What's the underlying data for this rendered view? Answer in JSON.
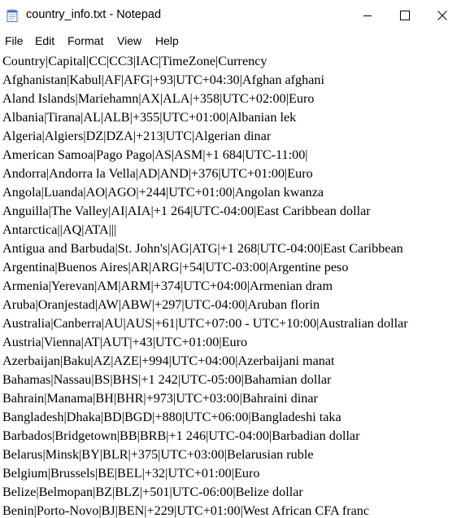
{
  "window": {
    "title": "country_info.txt - Notepad",
    "app_icon": "notepad-icon",
    "controls": {
      "minimize_icon": "minimize-icon",
      "maximize_icon": "maximize-icon",
      "close_icon": "close-icon"
    }
  },
  "menu": {
    "items": [
      {
        "label": "File"
      },
      {
        "label": "Edit"
      },
      {
        "label": "Format"
      },
      {
        "label": "View"
      },
      {
        "label": "Help"
      }
    ]
  },
  "document": {
    "lines": [
      "Country|Capital|CC|CC3|IAC|TimeZone|Currency",
      "Afghanistan|Kabul|AF|AFG|+93|UTC+04:30|Afghan afghani",
      "Aland Islands|Mariehamn|AX|ALA|+358|UTC+02:00|Euro",
      "Albania|Tirana|AL|ALB|+355|UTC+01:00|Albanian lek",
      "Algeria|Algiers|DZ|DZA|+213|UTC|Algerian dinar",
      "American Samoa|Pago Pago|AS|ASM|+1 684|UTC-11:00|",
      "Andorra|Andorra la Vella|AD|AND|+376|UTC+01:00|Euro",
      "Angola|Luanda|AO|AGO|+244|UTC+01:00|Angolan kwanza",
      "Anguilla|The Valley|AI|AIA|+1 264|UTC-04:00|East Caribbean dollar",
      "Antarctica||AQ|ATA|||",
      "Antigua and Barbuda|St. John's|AG|ATG|+1 268|UTC-04:00|East Caribbean",
      "Argentina|Buenos Aires|AR|ARG|+54|UTC-03:00|Argentine peso",
      "Armenia|Yerevan|AM|ARM|+374|UTC+04:00|Armenian dram",
      "Aruba|Oranjestad|AW|ABW|+297|UTC-04:00|Aruban florin",
      "Australia|Canberra|AU|AUS|+61|UTC+07:00 - UTC+10:00|Australian dollar",
      "Austria|Vienna|AT|AUT|+43|UTC+01:00|Euro",
      "Azerbaijan|Baku|AZ|AZE|+994|UTC+04:00|Azerbaijani manat",
      "Bahamas|Nassau|BS|BHS|+1 242|UTC-05:00|Bahamian dollar",
      "Bahrain|Manama|BH|BHR|+973|UTC+03:00|Bahraini dinar",
      "Bangladesh|Dhaka|BD|BGD|+880|UTC+06:00|Bangladeshi taka",
      "Barbados|Bridgetown|BB|BRB|+1 246|UTC-04:00|Barbadian dollar",
      "Belarus|Minsk|BY|BLR|+375|UTC+03:00|Belarusian ruble",
      "Belgium|Brussels|BE|BEL|+32|UTC+01:00|Euro",
      "Belize|Belmopan|BZ|BLZ|+501|UTC-06:00|Belize dollar",
      "Benin|Porto-Novo|BJ|BEN|+229|UTC+01:00|West African CFA franc"
    ]
  }
}
